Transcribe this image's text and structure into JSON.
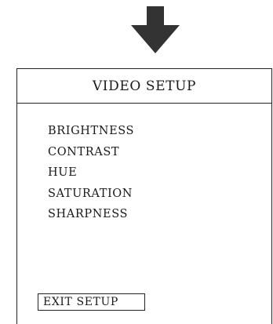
{
  "header": {
    "title": "VIDEO SETUP"
  },
  "menu": {
    "items": [
      {
        "label": "BRIGHTNESS"
      },
      {
        "label": "CONTRAST"
      },
      {
        "label": "HUE"
      },
      {
        "label": "SATURATION"
      },
      {
        "label": "SHARPNESS"
      }
    ]
  },
  "footer": {
    "exit_label": "EXIT SETUP"
  },
  "icons": {
    "arrow": "arrow-down-icon"
  },
  "colors": {
    "foreground": "#1a1a1a",
    "border": "#222222",
    "background": "#ffffff",
    "arrow": "#333333"
  }
}
